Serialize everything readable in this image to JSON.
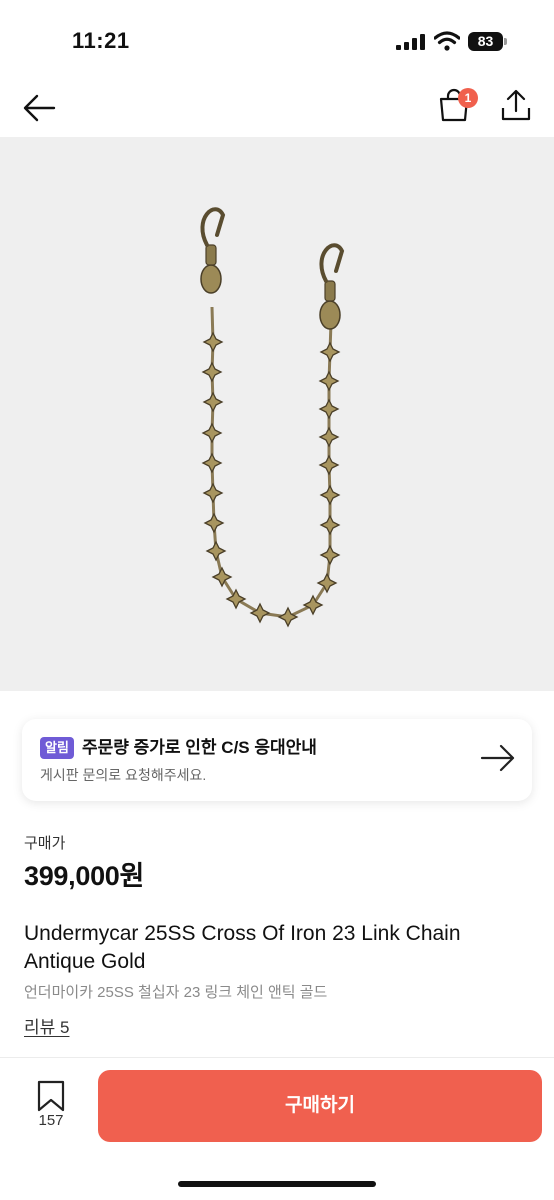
{
  "status_bar": {
    "time": "11:21",
    "battery": "83"
  },
  "nav": {
    "cart_badge": "1"
  },
  "notice": {
    "tag": "알림",
    "title": "주문량 증가로 인한 C/S 응대안내",
    "subtitle": "게시판 문의로 요청해주세요."
  },
  "price": {
    "label": "구매가",
    "value": "399,000원"
  },
  "product": {
    "title": "Undermycar 25SS Cross Of Iron 23 Link Chain Antique Gold",
    "subtitle": "언더마이카 25SS 철십자 23 링크 체인 앤틱 골드",
    "review_link": "리뷰 5"
  },
  "bottom_bar": {
    "wish_count": "157",
    "buy_label": "구매하기"
  },
  "colors": {
    "accent": "#f0604f",
    "tag": "#6f5bd6",
    "badge": "#f0604d"
  },
  "icons": [
    "back-arrow-icon",
    "shopping-bag-icon",
    "share-icon",
    "arrow-right-icon",
    "bookmark-icon"
  ]
}
